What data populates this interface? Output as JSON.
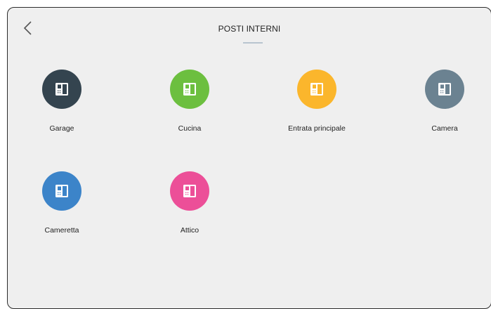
{
  "header": {
    "title": "POSTI INTERNI",
    "back_icon": "chevron-left-icon"
  },
  "devices": [
    {
      "label": "Garage",
      "color": "#34444f",
      "icon": "intercom-icon"
    },
    {
      "label": "Cucina",
      "color": "#6cbf3f",
      "icon": "intercom-icon"
    },
    {
      "label": "Entrata principale",
      "color": "#fbb62c",
      "icon": "intercom-icon"
    },
    {
      "label": "Camera",
      "color": "#6b8291",
      "icon": "intercom-icon"
    },
    {
      "label": "Cameretta",
      "color": "#3c84c9",
      "icon": "intercom-icon"
    },
    {
      "label": "Attico",
      "color": "#ec4f98",
      "icon": "intercom-icon"
    }
  ]
}
